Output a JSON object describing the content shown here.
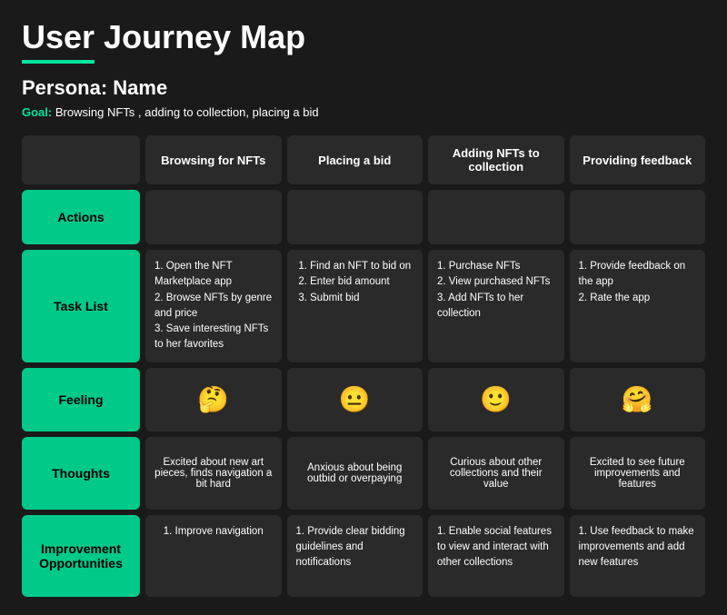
{
  "title": "User Journey Map",
  "persona_label": "Persona: Name",
  "goal_label": "Goal:",
  "goal_text": "Browsing NFTs , adding to collection, placing a bid",
  "headers": {
    "row_label": "",
    "col1": "Browsing for NFTs",
    "col2": "Placing a bid",
    "col3": "Adding NFTs to collection",
    "col4": "Providing feedback"
  },
  "rows": {
    "actions": {
      "label": "Actions",
      "col1": "",
      "col2": "",
      "col3": "",
      "col4": ""
    },
    "task_list": {
      "label": "Task List",
      "col1": "1. Open the NFT Marketplace app\n2. Browse NFTs by genre and price\n3. Save interesting NFTs to her favorites",
      "col2": "1. Find an NFT to bid on\n2. Enter bid amount\n3. Submit bid",
      "col3": "1. Purchase NFTs\n2. View purchased NFTs\n3. Add NFTs to her collection",
      "col4": "1. Provide feedback on the app\n2. Rate the app"
    },
    "feeling": {
      "label": "Feeling",
      "col1": "🤔",
      "col2": "😐",
      "col3": "🙂",
      "col4": "🤗"
    },
    "thoughts": {
      "label": "Thoughts",
      "col1": "Excited about new art pieces, finds navigation a bit hard",
      "col2": "Anxious about being outbid or overpaying",
      "col3": "Curious about other collections and their value",
      "col4": "Excited to see future improvements and features"
    },
    "improvement": {
      "label": "Improvement Opportunities",
      "col1": "1. Improve navigation",
      "col2": "1. Provide clear bidding guidelines and notifications",
      "col3": "1. Enable social features to view and interact with other collections",
      "col4": "1. Use feedback to make improvements and add new features"
    }
  }
}
